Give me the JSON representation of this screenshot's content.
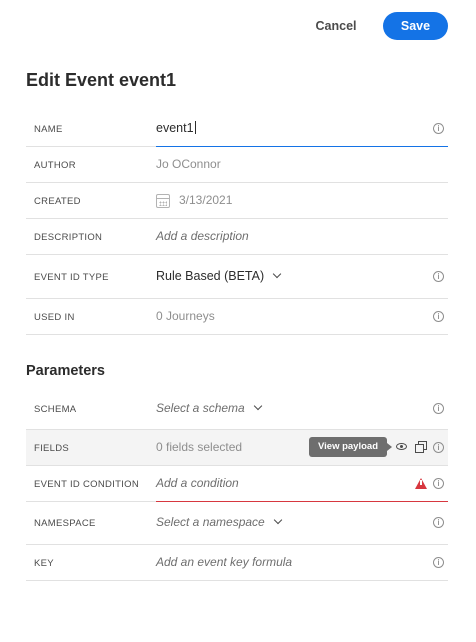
{
  "actions": {
    "cancel_label": "Cancel",
    "save_label": "Save"
  },
  "page_title": "Edit Event event1",
  "fields": {
    "name": {
      "label": "NAME",
      "value": "event1"
    },
    "author": {
      "label": "AUTHOR",
      "value": "Jo OConnor"
    },
    "created": {
      "label": "CREATED",
      "value": "3/13/2021"
    },
    "description": {
      "label": "DESCRIPTION",
      "placeholder": "Add a description"
    },
    "event_id_type": {
      "label": "EVENT ID TYPE",
      "value": "Rule Based (BETA)"
    },
    "used_in": {
      "label": "USED IN",
      "value": "0 Journeys"
    }
  },
  "parameters": {
    "title": "Parameters",
    "schema": {
      "label": "SCHEMA",
      "placeholder": "Select a schema"
    },
    "fields": {
      "label": "FIELDS",
      "value": "0 fields selected",
      "tooltip": "View payload"
    },
    "event_id_condition": {
      "label": "EVENT ID CONDITION",
      "placeholder": "Add a condition"
    },
    "namespace": {
      "label": "NAMESPACE",
      "placeholder": "Select a namespace"
    },
    "key": {
      "label": "KEY",
      "placeholder": "Add an event key formula"
    }
  },
  "icons": {
    "info": "info-icon",
    "calendar": "calendar-icon",
    "alert": "alert-icon",
    "eye": "eye-icon",
    "copy": "copy-icon",
    "chevron": "chevron-down-icon"
  },
  "colors": {
    "accent": "#1473e6",
    "error": "#d7373f"
  }
}
